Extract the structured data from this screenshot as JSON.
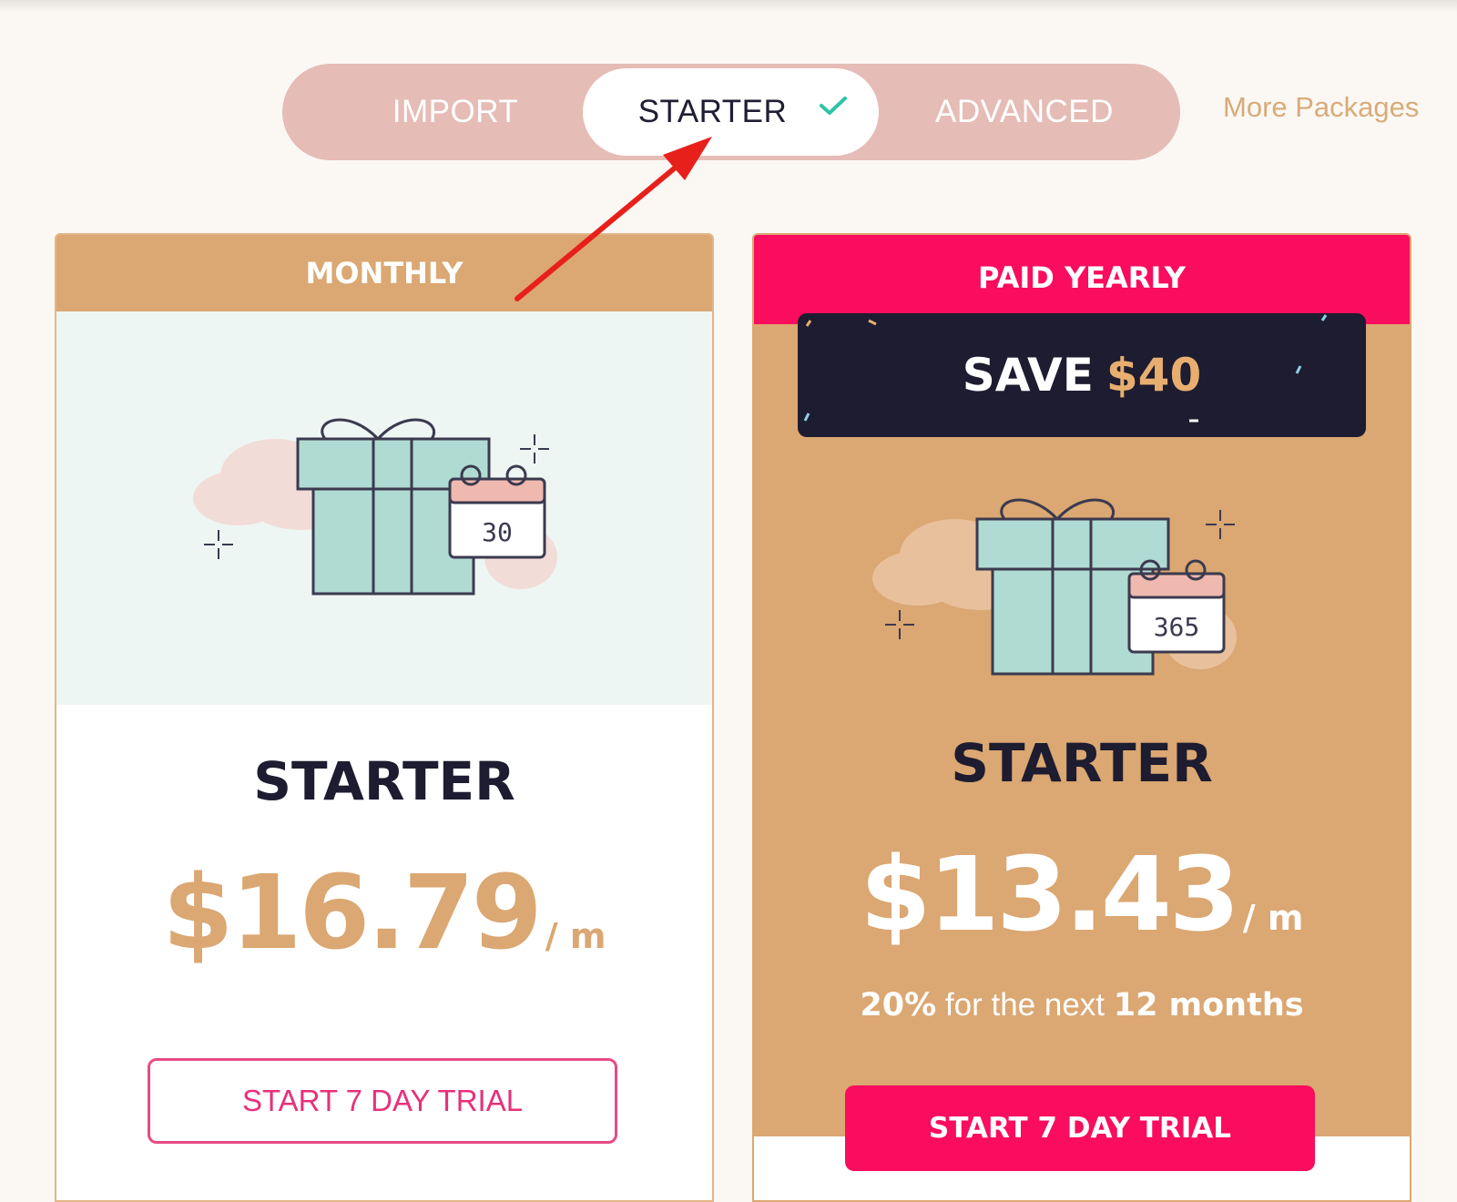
{
  "switcher": {
    "tabs": [
      "IMPORT",
      "STARTER",
      "ADVANCED"
    ],
    "selected": "STARTER",
    "more_link": "More Packages"
  },
  "monthly": {
    "header": "MONTHLY",
    "calendar_number": "30",
    "plan": "STARTER",
    "price": "$16.79",
    "period": "/ m",
    "button": "START 7 DAY TRIAL"
  },
  "yearly": {
    "header": "PAID YEARLY",
    "save_label": "SAVE",
    "save_amount": "$40",
    "calendar_number": "365",
    "plan": "STARTER",
    "price": "$13.43",
    "period": "/ m",
    "note_percent": "20%",
    "note_middle": "for the next",
    "note_duration": "12 months",
    "button": "START 7 DAY TRIAL"
  },
  "colors": {
    "accent_tan": "#dba772",
    "accent_pink": "#fa0c5e",
    "dark_navy": "#1d1c30",
    "switch_bg": "#e6bcb6",
    "check_teal": "#2ec4a6",
    "annotation_red": "#e8201c"
  },
  "icons": [
    "check-icon",
    "gift-icon",
    "calendar-icon",
    "sparkle-icon",
    "cloud-icon",
    "annotation-arrow"
  ]
}
